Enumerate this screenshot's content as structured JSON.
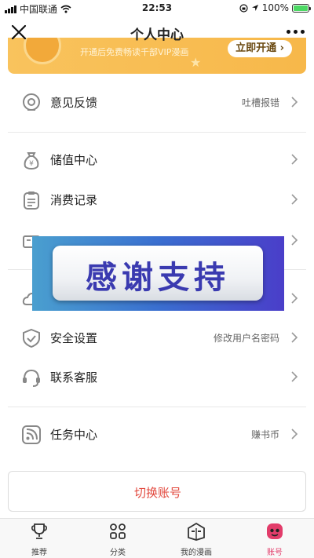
{
  "status_bar": {
    "carrier": "中国联通",
    "time": "22:53",
    "battery_text": "100%",
    "battery_level": 1.0
  },
  "nav": {
    "title": "个人中心"
  },
  "vip_banner": {
    "text": "开通后免费畅读千部VIP漫画",
    "button_label": "立即开通 ›"
  },
  "menu": {
    "feedback": {
      "label": "意见反馈",
      "hint": "吐槽报错",
      "icon": "feedback-icon"
    },
    "recharge": {
      "label": "储值中心",
      "hint": "",
      "icon": "money-bag-icon"
    },
    "records": {
      "label": "消费记录",
      "hint": "",
      "icon": "clipboard-icon"
    },
    "hidden_item": {
      "label": "",
      "hint": "",
      "icon": "ticket-icon"
    },
    "cloud": {
      "label": "",
      "hint": "",
      "icon": "cloud-icon"
    },
    "security": {
      "label": "安全设置",
      "hint": "修改用户名密码",
      "icon": "shield-icon"
    },
    "support": {
      "label": "联系客服",
      "hint": "",
      "icon": "headset-icon"
    },
    "tasks": {
      "label": "任务中心",
      "hint": "赚书币",
      "icon": "rss-icon"
    }
  },
  "overlay": {
    "text": "感谢支持"
  },
  "switch_account": {
    "label": "切换账号"
  },
  "tabs": [
    {
      "label": "推荐",
      "icon": "trophy-icon",
      "active": false
    },
    {
      "label": "分类",
      "icon": "grid-icon",
      "active": false
    },
    {
      "label": "我的漫画",
      "icon": "book-icon",
      "active": false
    },
    {
      "label": "账号",
      "icon": "user-icon",
      "active": true
    }
  ],
  "colors": {
    "accent": "#e23c6a",
    "switch_text": "#e2473c",
    "vip_gold": "#f7b84a"
  }
}
